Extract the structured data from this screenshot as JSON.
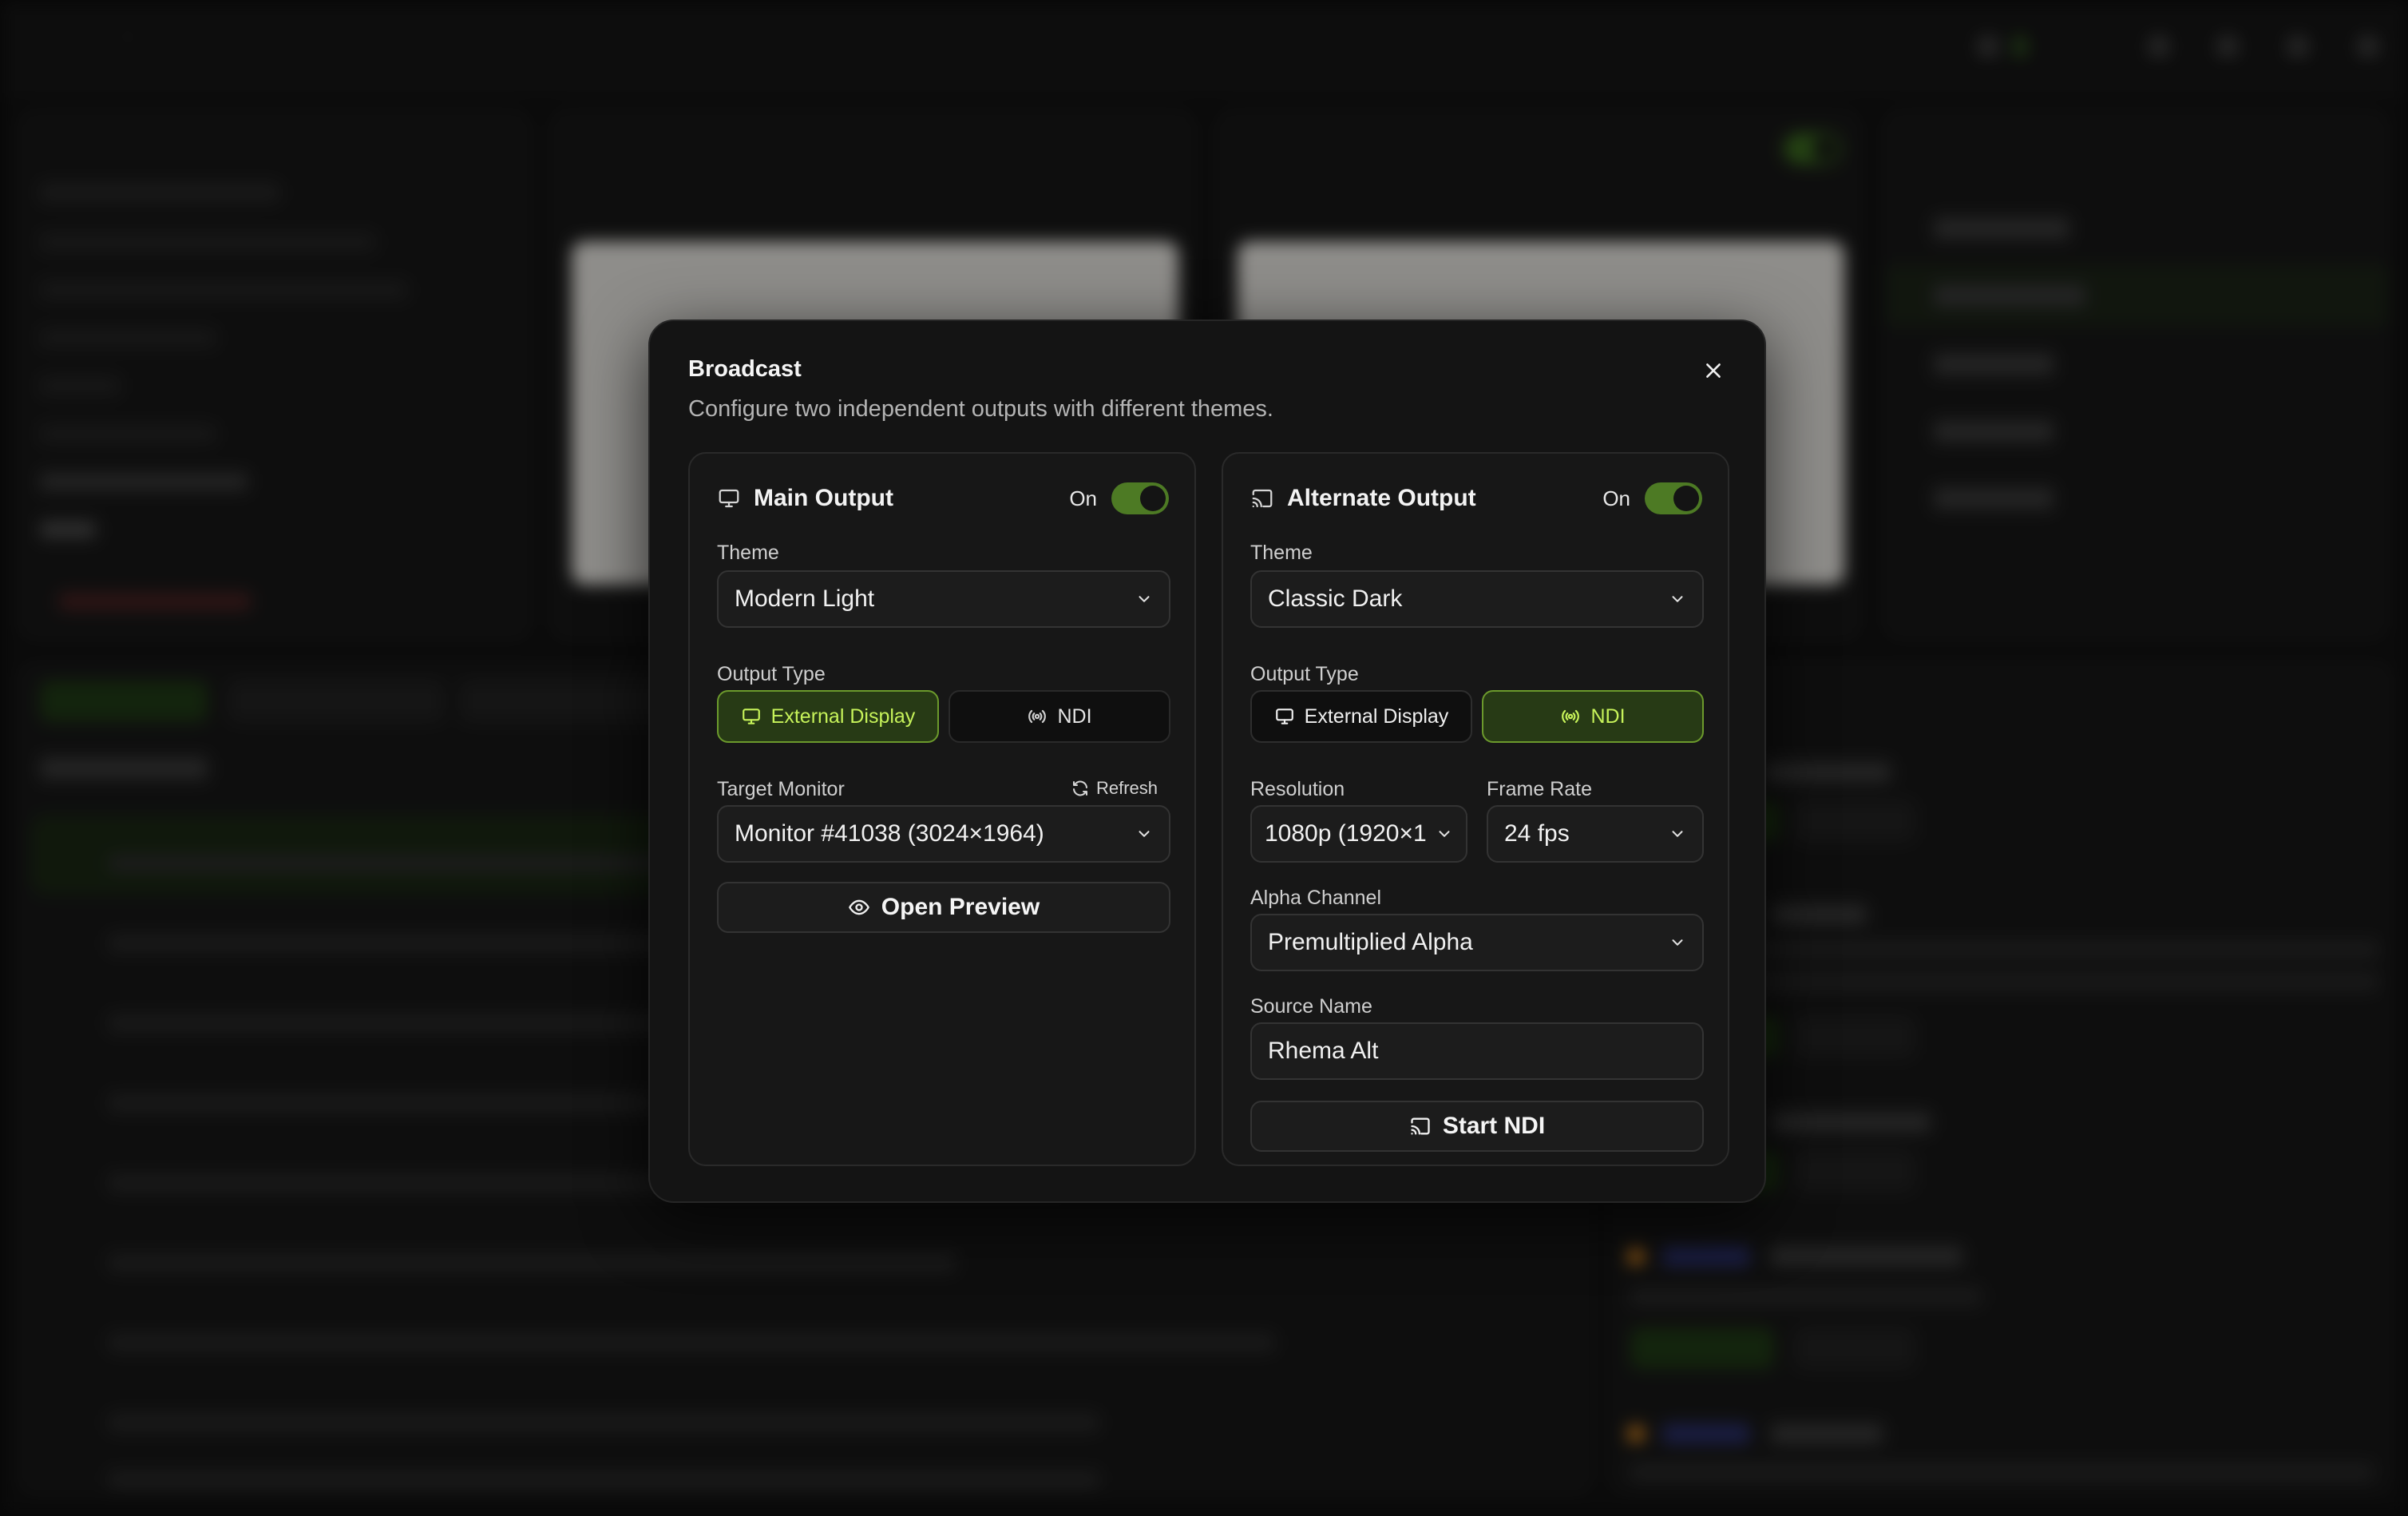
{
  "modal": {
    "title": "Broadcast",
    "description": "Configure two independent outputs with different themes.",
    "main_output": {
      "title": "Main Output",
      "toggle_label": "On",
      "enabled": true,
      "theme_label": "Theme",
      "theme_value": "Modern Light",
      "output_type_label": "Output Type",
      "output_type_options": [
        "External Display",
        "NDI"
      ],
      "output_type_selected": "External Display",
      "target_monitor_label": "Target Monitor",
      "refresh_label": "Refresh",
      "target_monitor_value": "Monitor #41038 (3024×1964)",
      "open_preview_label": "Open Preview"
    },
    "alternate_output": {
      "title": "Alternate Output",
      "toggle_label": "On",
      "enabled": true,
      "theme_label": "Theme",
      "theme_value": "Classic Dark",
      "output_type_label": "Output Type",
      "output_type_options": [
        "External Display",
        "NDI"
      ],
      "output_type_selected": "NDI",
      "resolution_label": "Resolution",
      "resolution_value": "1080p (1920×1",
      "frame_rate_label": "Frame Rate",
      "frame_rate_value": "24 fps",
      "alpha_channel_label": "Alpha Channel",
      "alpha_channel_value": "Premultiplied Alpha",
      "source_name_label": "Source Name",
      "source_name_value": "Rhema Alt",
      "start_ndi_label": "Start NDI"
    }
  },
  "colors": {
    "accent": "#4d7a24",
    "accent_text": "#c7f35a",
    "modal_bg": "#141414",
    "card_bg": "#171717"
  },
  "icons": {
    "main_output": "monitor-icon",
    "alternate_output": "cast-icon",
    "close": "close-icon",
    "chevron": "chevron-down-icon",
    "external_display": "monitor-icon",
    "ndi": "broadcast-icon",
    "refresh": "refresh-icon",
    "open_preview": "eye-icon",
    "start_ndi": "cast-icon"
  }
}
